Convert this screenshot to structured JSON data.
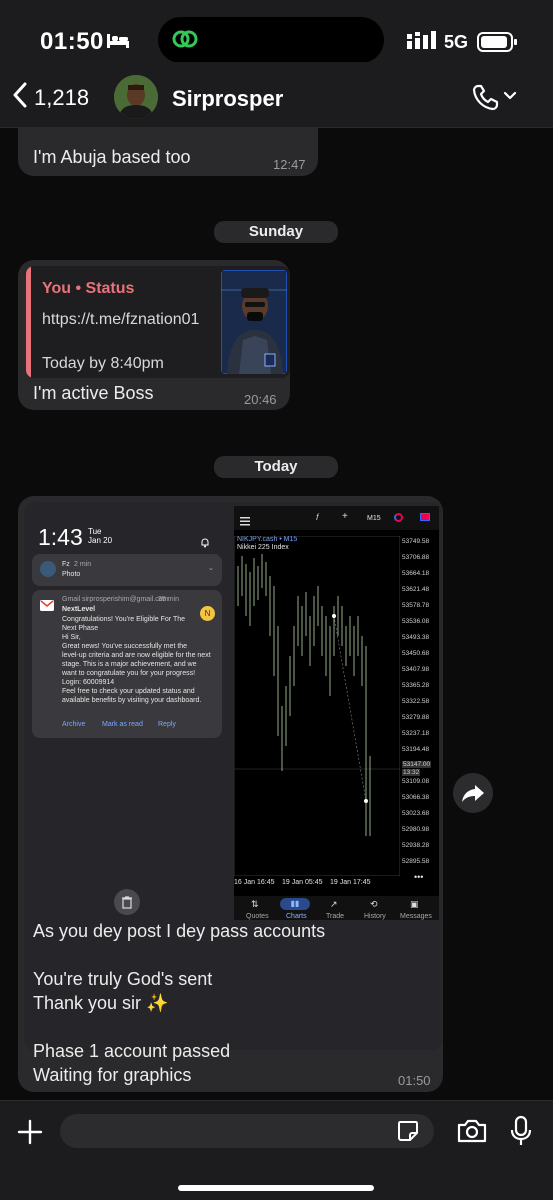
{
  "status_bar": {
    "time": "01:50",
    "network": "5G"
  },
  "header": {
    "back_count": "1,218",
    "contact_name": "Sirprosper"
  },
  "messages": [
    {
      "id": "m1",
      "text": "I'm Abuja based too",
      "time": "12:47"
    },
    {
      "id": "d1",
      "date": "Sunday"
    },
    {
      "id": "m2",
      "reply": {
        "title": "You • Status",
        "link": "https://t.me/fznation01",
        "when": "Today by 8:40pm"
      },
      "text": "I'm active Boss",
      "time": "20:46"
    },
    {
      "id": "d2",
      "date": "Today"
    },
    {
      "id": "m3",
      "lines": [
        "As you dey post I dey pass accounts",
        "",
        "You're truly God's sent",
        "Thank you sir ✨",
        "",
        "Phase 1 account passed",
        "Waiting for graphics"
      ],
      "time": "01:50"
    }
  ],
  "screenshot": {
    "lock_time": "1:43",
    "lock_day": "Tue",
    "lock_date": "Jan 20",
    "notif1": {
      "app": "Fz",
      "age": "2 min",
      "body": "Photo"
    },
    "notif2": {
      "app": "Gmail",
      "account": "sirprosperishim@gmail.com",
      "age": "35 min",
      "sender": "NextLevel",
      "avatar": "N",
      "lines": [
        "Congratulations! You're Eligible For The",
        "Next Phase",
        "Hi Sir,",
        "Great news! You've successfully met the",
        "level-up criteria and are now eligible for the next",
        "stage. This is a major achievement, and we",
        "want to congratulate you for your progress!",
        "Login: 60009914",
        "Feel free to check your updated status and",
        "available benefits by visiting your dashboard."
      ],
      "actions": [
        "Archive",
        "Mark as read",
        "Reply"
      ]
    },
    "chart": {
      "timeframe": "M15",
      "symbol": "NIKJPY.cash • M15",
      "instrument": "Nikkei 225 Index",
      "prices": [
        "53749.58",
        "53706.88",
        "53664.18",
        "53621.48",
        "53578.78",
        "53536.08",
        "53493.38",
        "53450.68",
        "53407.98",
        "53365.28",
        "53322.58",
        "53279.88",
        "53237.18",
        "53194.48",
        "53147.00",
        "13:32",
        "53109.08",
        "53066.38",
        "53023.68",
        "52980.98",
        "52938.28",
        "52895.58"
      ],
      "time_labels": [
        "16 Jan 16:45",
        "19 Jan 05:45",
        "19 Jan 17:45"
      ],
      "tabs": [
        "Quotes",
        "Charts",
        "Trade",
        "History",
        "Messages"
      ]
    }
  },
  "input": {
    "placeholder": ""
  }
}
